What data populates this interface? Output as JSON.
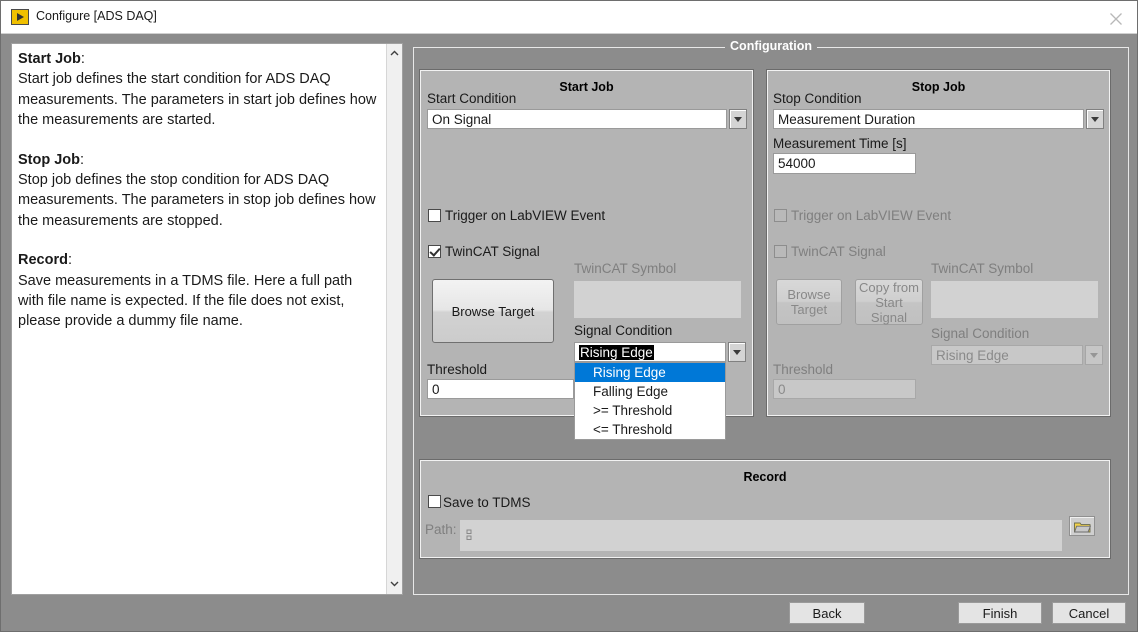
{
  "window": {
    "title": "Configure [ADS DAQ]",
    "icon": "labview-run-icon",
    "close_label": "close-icon"
  },
  "help": {
    "sections": [
      {
        "heading": "Start Job",
        "body": "Start job defines the start condition for ADS DAQ measurements. The parameters in start job defines how the measurements are started."
      },
      {
        "heading": "Stop Job",
        "body": "Stop job defines the stop condition for ADS DAQ measurements. The parameters in stop job defines how the measurements are stopped."
      },
      {
        "heading": "Record",
        "body": "Save measurements in a TDMS file. Here a full path with file name is expected. If the file does not exist, please provide a dummy file name."
      }
    ]
  },
  "configuration": {
    "group_title": "Configuration",
    "start_job": {
      "title": "Start Job",
      "start_condition_label": "Start Condition",
      "start_condition_value": "On Signal",
      "trigger_labview_label": "Trigger on LabVIEW Event",
      "trigger_labview_checked": false,
      "twincat_signal_label": "TwinCAT Signal",
      "twincat_signal_checked": true,
      "browse_target_label": "Browse Target",
      "twincat_symbol_label": "TwinCAT Symbol",
      "twincat_symbol_value": "",
      "signal_condition_label": "Signal Condition",
      "signal_condition_value": "Rising Edge",
      "signal_condition_options": [
        "Rising Edge",
        "Falling Edge",
        ">= Threshold",
        "<= Threshold"
      ],
      "signal_condition_selected_index": 0,
      "threshold_label": "Threshold",
      "threshold_value": "0"
    },
    "stop_job": {
      "title": "Stop Job",
      "stop_condition_label": "Stop Condition",
      "stop_condition_value": "Measurement Duration",
      "measurement_time_label": "Measurement Time [s]",
      "measurement_time_value": "54000",
      "trigger_labview_label": "Trigger on LabVIEW Event",
      "trigger_labview_checked": false,
      "twincat_signal_label": "TwinCAT Signal",
      "twincat_signal_checked": false,
      "browse_target_label": "Browse\nTarget",
      "browse_target_line1": "Browse",
      "browse_target_line2": "Target",
      "copy_from_start_line1": "Copy from",
      "copy_from_start_line2": "Start Signal",
      "twincat_symbol_label": "TwinCAT Symbol",
      "twincat_symbol_value": "",
      "signal_condition_label": "Signal Condition",
      "signal_condition_value": "Rising Edge",
      "threshold_label": "Threshold",
      "threshold_value": "0"
    },
    "record": {
      "title": "Record",
      "save_tdms_label": "Save to TDMS",
      "save_tdms_checked": false,
      "path_label": "Path:",
      "path_value": "",
      "browse_folder_icon": "folder-open-icon"
    }
  },
  "footer": {
    "back_label": "Back",
    "finish_label": "Finish",
    "cancel_label": "Cancel"
  },
  "colors": {
    "window_bg": "#8c8c8c",
    "panel_bg": "#b4b4b4",
    "highlight": "#0078d7",
    "accent_icon": "#f0c000"
  }
}
